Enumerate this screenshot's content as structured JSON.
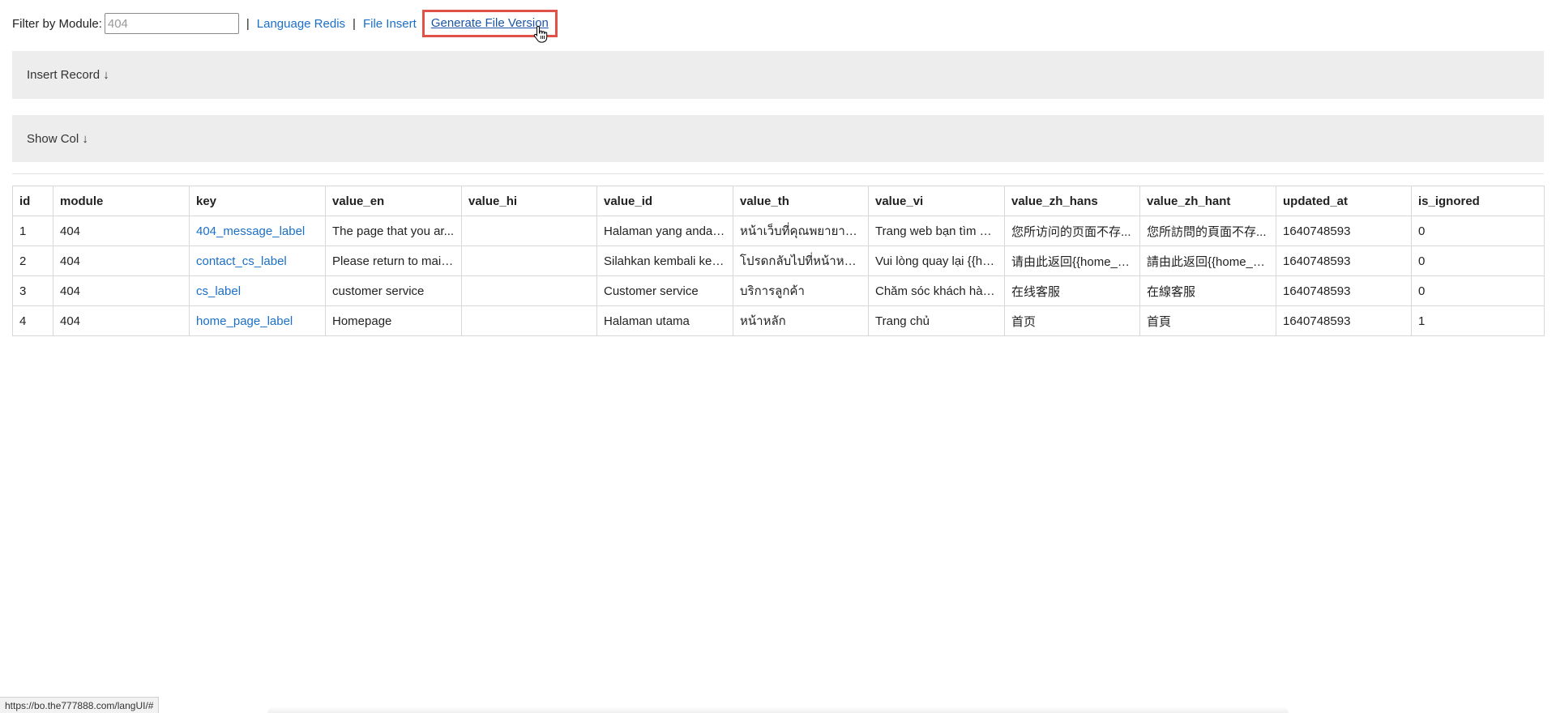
{
  "toolbar": {
    "filter_label": "Filter by Module:",
    "filter_placeholder": "404",
    "separator": "|",
    "links": {
      "language_redis": "Language Redis",
      "file_insert": "File Insert",
      "generate_file_version": "Generate File Version"
    }
  },
  "panels": {
    "insert_record": "Insert Record ↓",
    "show_col": "Show Col ↓"
  },
  "table": {
    "columns": [
      "id",
      "module",
      "key",
      "value_en",
      "value_hi",
      "value_id",
      "value_th",
      "value_vi",
      "value_zh_hans",
      "value_zh_hant",
      "updated_at",
      "is_ignored"
    ],
    "rows": [
      {
        "id": "1",
        "module": "404",
        "key": "404_message_label",
        "value_en": "The page that you ar...",
        "value_hi": "",
        "value_id": "Halaman yang anda i...",
        "value_th": "หน้าเว็บที่คุณพยายามเข้...",
        "value_vi": "Trang web bạn tìm ki...",
        "value_zh_hans": "您所访问的页面不存...",
        "value_zh_hant": "您所訪問的頁面不存...",
        "updated_at": "1640748593",
        "is_ignored": "0"
      },
      {
        "id": "2",
        "module": "404",
        "key": "contact_cs_label",
        "value_en": "Please return to main...",
        "value_hi": "",
        "value_id": "Silahkan kembali ke h...",
        "value_th": "โปรดกลับไปที่หน้าหลัก ...",
        "value_vi": "Vui lòng quay lại {{ho...",
        "value_zh_hans": "请由此返回{{home_p...",
        "value_zh_hant": "請由此返回{{home_p...",
        "updated_at": "1640748593",
        "is_ignored": "0"
      },
      {
        "id": "3",
        "module": "404",
        "key": "cs_label",
        "value_en": "customer service",
        "value_hi": "",
        "value_id": "Customer service",
        "value_th": "บริการลูกค้า",
        "value_vi": "Chăm sóc khách hàn...",
        "value_zh_hans": "在线客服",
        "value_zh_hant": "在線客服",
        "updated_at": "1640748593",
        "is_ignored": "0"
      },
      {
        "id": "4",
        "module": "404",
        "key": "home_page_label",
        "value_en": "Homepage",
        "value_hi": "",
        "value_id": "Halaman utama",
        "value_th": "หน้าหลัก",
        "value_vi": "Trang chủ",
        "value_zh_hans": "首页",
        "value_zh_hant": "首頁",
        "updated_at": "1640748593",
        "is_ignored": "1"
      }
    ]
  },
  "status_bar": {
    "url": "https://bo.the777888.com/langUI/#"
  },
  "colors": {
    "link": "#1a6fc9",
    "highlight_border": "#e05248",
    "panel_bg": "#ededed"
  },
  "icons": {
    "cursor": "hand-pointer-icon"
  }
}
